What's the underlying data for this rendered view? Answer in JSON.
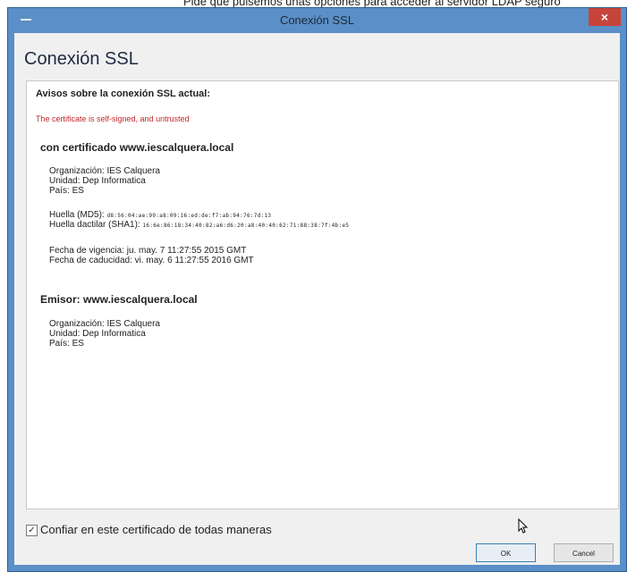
{
  "page": {
    "top_text": "Pide que pulsemos unas opciones para acceder al servidor LDAP seguro"
  },
  "window": {
    "title": "Conexión SSL",
    "close_glyph": "×",
    "heading": "Conexión SSL"
  },
  "warnings": {
    "title": "Avisos sobre la conexión SSL actual:",
    "message": "The certificate is self-signed, and untrusted"
  },
  "certificate": {
    "title": "con certificado www.iescalquera.local",
    "organization": "Organización: IES Calquera",
    "unit": "Unidad: Dep Informatica",
    "country": "País: ES",
    "md5_label": "Huella (MD5):",
    "md5_value": "d8:56:04:ae:99:a8:09:16:ed:de:f7:ab:94:76:7d:13",
    "sha1_label": "Huella dactilar (SHA1):",
    "sha1_value": "16:6e:86:18:34:40:82:a6:d6:20:a8:40:40:62:71:88:38:7f:4b:e5",
    "valid_from": "Fecha de vigencia: ju. may. 7 11:27:55 2015 GMT",
    "valid_to": "Fecha de caducidad: vi. may. 6 11:27:55 2016 GMT"
  },
  "issuer": {
    "title": "Emisor: www.iescalquera.local",
    "organization": "Organización: IES Calquera",
    "unit": "Unidad: Dep Informatica",
    "country": "País: ES"
  },
  "trust": {
    "checked": true,
    "check_glyph": "✓",
    "label": "Confiar en este certificado de todas maneras"
  },
  "buttons": {
    "ok": "OK",
    "cancel": "Cancel"
  },
  "colors": {
    "titlebar": "#5b8fc7",
    "close": "#c7443a",
    "warning": "#c0282e"
  }
}
